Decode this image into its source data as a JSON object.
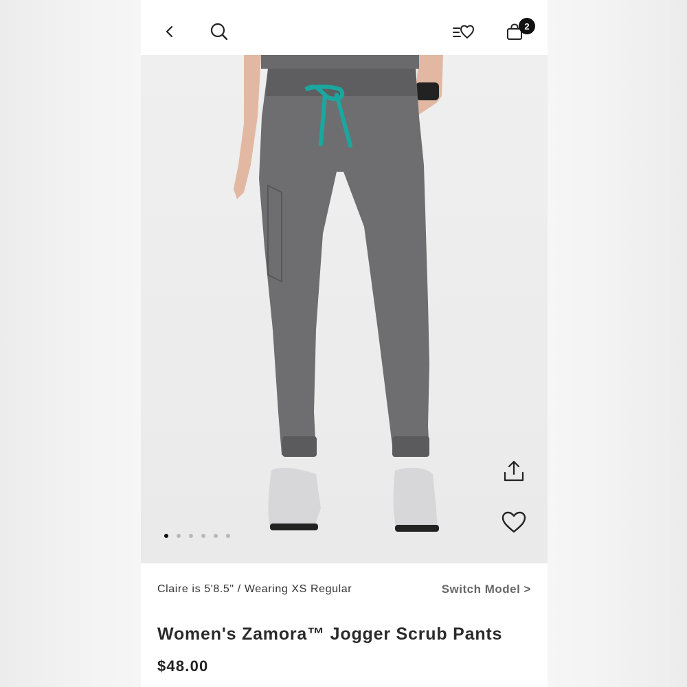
{
  "header": {
    "back_icon": "chevron-left-icon",
    "search_icon": "search-icon",
    "wishlist_icon": "list-heart-icon",
    "bag_icon": "shopping-bag-icon",
    "bag_count": "2"
  },
  "gallery": {
    "image": "gray jogger scrub pants with teal drawstring worn by model",
    "share_icon": "share-icon",
    "favorite_icon": "heart-icon",
    "page_count": 6,
    "active_page": 1
  },
  "product": {
    "model_info": "Claire is 5'8.5\" / Wearing XS Regular",
    "switch_model_label": "Switch Model >",
    "title": "Women's Zamora™ Jogger Scrub Pants",
    "price": "$48.00"
  },
  "colors": {
    "pants": "#6e6e70",
    "drawstring": "#1aa7a0",
    "background": "#ebebeb"
  }
}
